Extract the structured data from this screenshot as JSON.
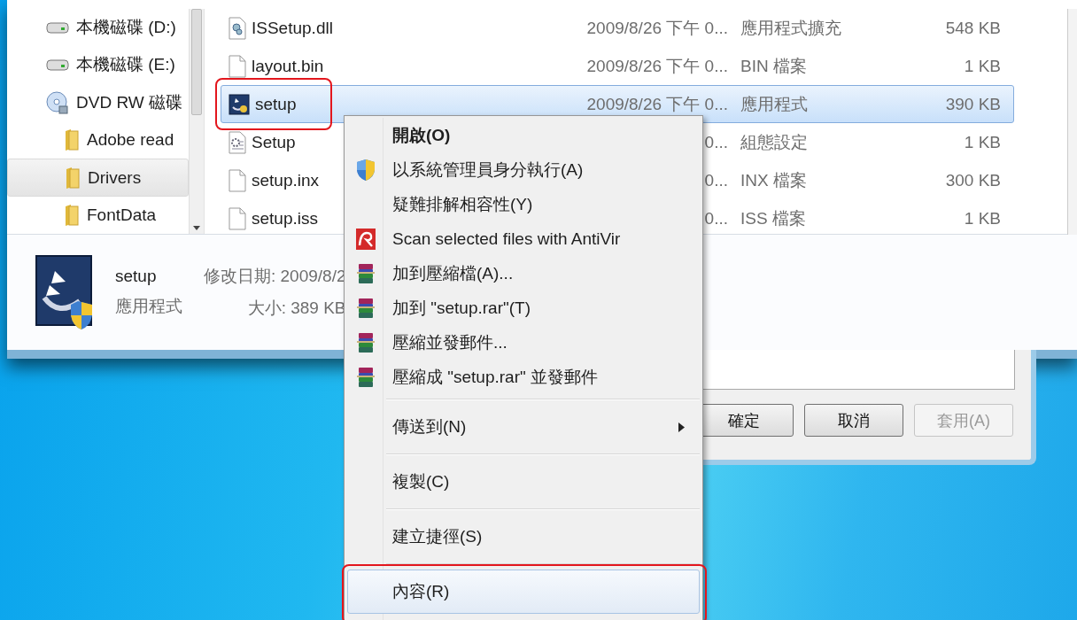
{
  "nav": {
    "items": [
      {
        "kind": "drive",
        "label": "本機磁碟 (D:)",
        "selected": false
      },
      {
        "kind": "drive",
        "label": "本機磁碟 (E:)",
        "selected": false
      },
      {
        "kind": "optical",
        "label": "DVD RW 磁碟",
        "selected": false,
        "children": [
          {
            "kind": "folder",
            "label": "Adobe read",
            "selected": false
          },
          {
            "kind": "folder",
            "label": "Drivers",
            "selected": true
          },
          {
            "kind": "folder",
            "label": "FontData",
            "selected": false
          }
        ]
      }
    ]
  },
  "files": [
    {
      "kind": "dll",
      "name": "ISSetup.dll",
      "date": "2009/8/26 下午 0...",
      "type": "應用程式擴充",
      "size": "548 KB",
      "selected": false,
      "highlighted": false
    },
    {
      "kind": "file",
      "name": "layout.bin",
      "date": "2009/8/26 下午 0...",
      "type": "BIN 檔案",
      "size": "1 KB",
      "selected": false,
      "highlighted": false
    },
    {
      "kind": "app",
      "name": "setup",
      "date": "2009/8/26 下午 0...",
      "type": "應用程式",
      "size": "390 KB",
      "selected": true,
      "highlighted": true
    },
    {
      "kind": "config",
      "name": "Setup",
      "date": "0...",
      "type": "組態設定",
      "size": "1 KB",
      "selected": false,
      "highlighted": false
    },
    {
      "kind": "file",
      "name": "setup.inx",
      "date": "0...",
      "type": "INX 檔案",
      "size": "300 KB",
      "selected": false,
      "highlighted": false
    },
    {
      "kind": "file",
      "name": "setup.iss",
      "date": "0...",
      "type": "ISS 檔案",
      "size": "1 KB",
      "selected": false,
      "highlighted": false
    }
  ],
  "details": {
    "name": "setup",
    "type": "應用程式",
    "modified": "修改日期: 2009/8/2",
    "size": "大小: 389 KB"
  },
  "dialog": {
    "buttons": [
      {
        "label": "確定",
        "disabled": false
      },
      {
        "label": "取消",
        "disabled": false
      },
      {
        "label": "套用(A)",
        "disabled": true
      }
    ]
  },
  "menu": {
    "items": [
      {
        "kind": "plain",
        "label": "開啟(O)",
        "default": true,
        "hovered": false,
        "highlighted": false
      },
      {
        "kind": "shield",
        "label": "以系統管理員身分執行(A)",
        "default": false,
        "hovered": false,
        "highlighted": false
      },
      {
        "kind": "plain",
        "label": "疑難排解相容性(Y)",
        "default": false,
        "hovered": false,
        "highlighted": false
      },
      {
        "kind": "antivirus",
        "label": "Scan selected files with AntiVir",
        "default": false,
        "hovered": false,
        "highlighted": false
      },
      {
        "kind": "archive",
        "label": "加到壓縮檔(A)...",
        "default": false,
        "hovered": false,
        "highlighted": false
      },
      {
        "kind": "archive",
        "label": "加到 \"setup.rar\"(T)",
        "default": false,
        "hovered": false,
        "highlighted": false
      },
      {
        "kind": "archive",
        "label": "壓縮並發郵件...",
        "default": false,
        "hovered": false,
        "highlighted": false
      },
      {
        "kind": "archive",
        "label": "壓縮成 \"setup.rar\" 並發郵件",
        "default": false,
        "hovered": false,
        "highlighted": false
      },
      {
        "kind": "separator"
      },
      {
        "kind": "submenu",
        "label": "傳送到(N)",
        "default": false,
        "hovered": false,
        "highlighted": false
      },
      {
        "kind": "separator"
      },
      {
        "kind": "plain",
        "label": "複製(C)",
        "default": false,
        "hovered": false,
        "highlighted": false
      },
      {
        "kind": "separator"
      },
      {
        "kind": "plain",
        "label": "建立捷徑(S)",
        "default": false,
        "hovered": false,
        "highlighted": false
      },
      {
        "kind": "separator"
      },
      {
        "kind": "plain",
        "label": "內容(R)",
        "default": false,
        "hovered": true,
        "highlighted": true
      }
    ]
  }
}
